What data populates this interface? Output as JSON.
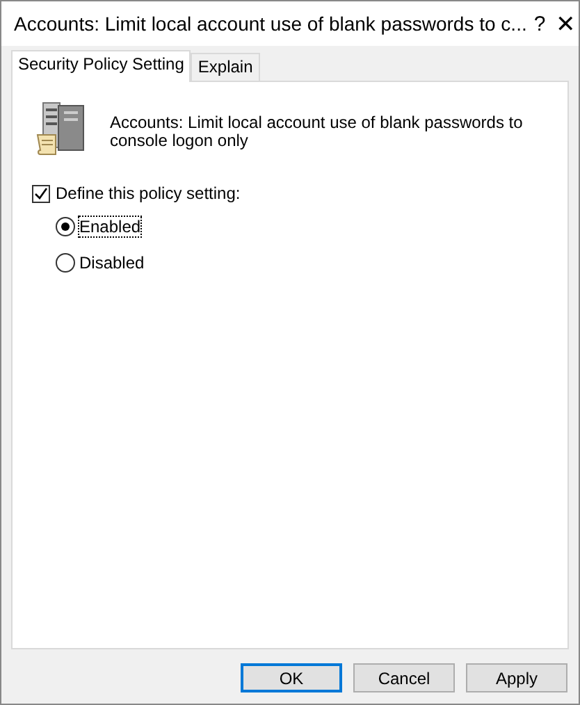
{
  "window": {
    "title": "Accounts: Limit local account use of blank passwords to c...",
    "help_button": "?",
    "close_button": "✕"
  },
  "tabs": [
    {
      "label": "Security Policy Setting",
      "selected": true
    },
    {
      "label": "Explain",
      "selected": false
    }
  ],
  "policy": {
    "description": "Accounts: Limit local account use of blank passwords to console logon only"
  },
  "define_checkbox": {
    "label": "Define this policy setting:",
    "checked": true
  },
  "options": [
    {
      "label": "Enabled",
      "selected": true,
      "focused": true
    },
    {
      "label": "Disabled",
      "selected": false,
      "focused": false
    }
  ],
  "buttons": [
    {
      "label": "OK",
      "default": true
    },
    {
      "label": "Cancel",
      "default": false
    },
    {
      "label": "Apply",
      "default": false
    }
  ]
}
